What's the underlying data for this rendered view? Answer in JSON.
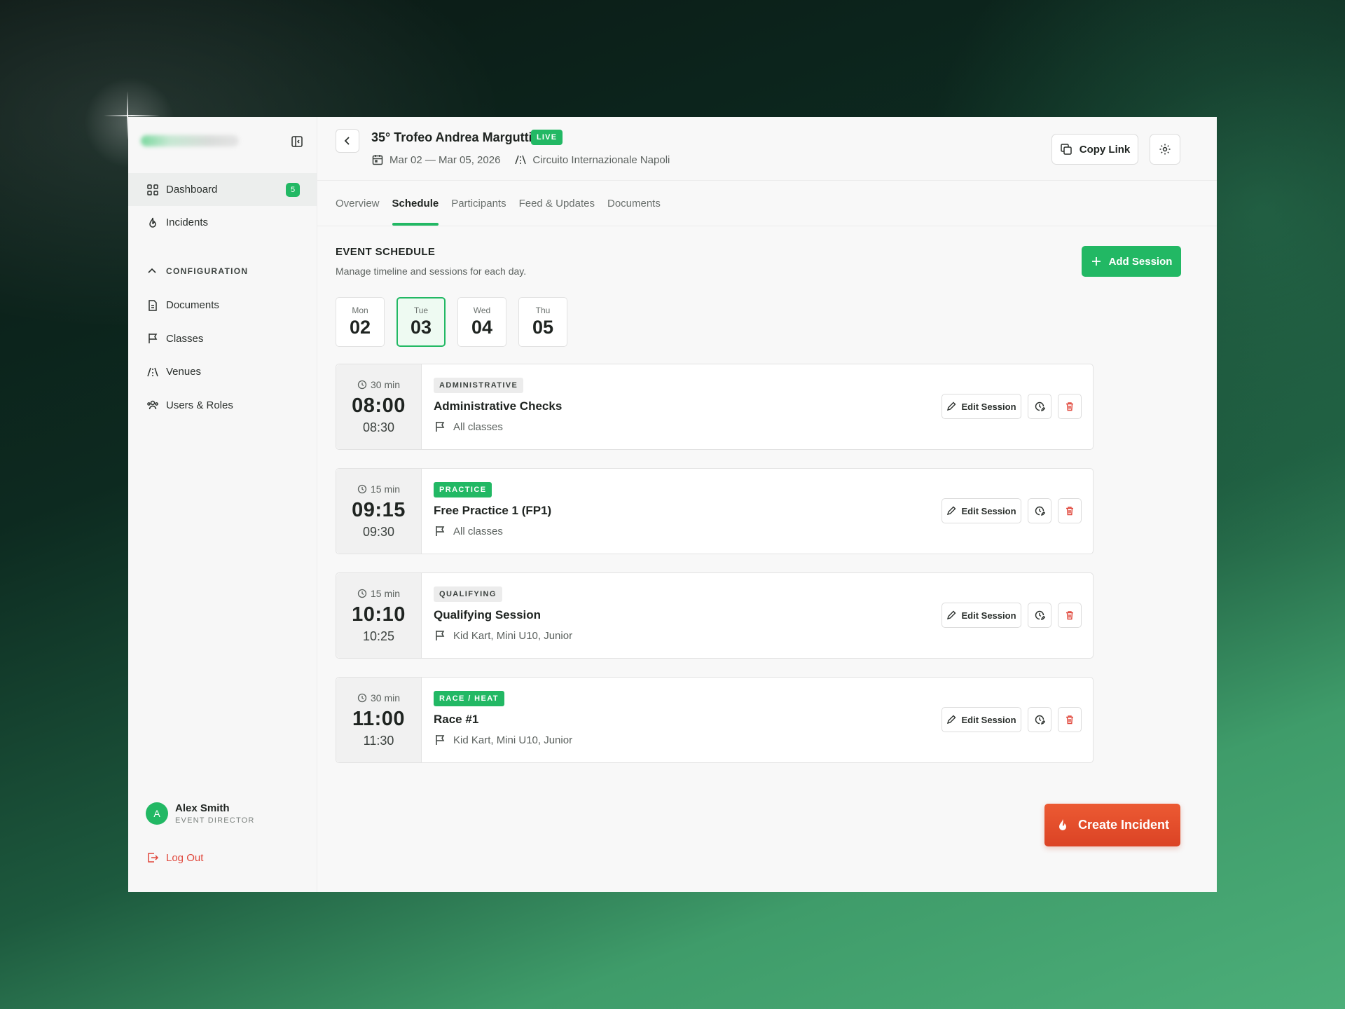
{
  "sidebar": {
    "nav": [
      {
        "label": "Dashboard",
        "icon": "grid-icon",
        "badge": "5",
        "active": true
      },
      {
        "label": "Incidents",
        "icon": "flame-icon"
      }
    ],
    "config_heading": "CONFIGURATION",
    "config_items": [
      {
        "label": "Documents",
        "icon": "document-icon"
      },
      {
        "label": "Classes",
        "icon": "flag-icon"
      },
      {
        "label": "Venues",
        "icon": "track-icon"
      },
      {
        "label": "Users & Roles",
        "icon": "users-icon"
      }
    ],
    "user": {
      "initial": "A",
      "name": "Alex Smith",
      "role": "EVENT DIRECTOR"
    },
    "logout_label": "Log Out"
  },
  "event": {
    "title": "35° Trofeo Andrea Margutti",
    "status": "LIVE",
    "dates": "Mar 02 — Mar 05, 2026",
    "venue": "Circuito Internazionale Napoli",
    "copy_label": "Copy Link"
  },
  "tabs": [
    {
      "label": "Overview"
    },
    {
      "label": "Schedule",
      "active": true
    },
    {
      "label": "Participants"
    },
    {
      "label": "Feed & Updates"
    },
    {
      "label": "Documents"
    }
  ],
  "schedule": {
    "title": "EVENT SCHEDULE",
    "subtitle": "Manage timeline and sessions for each day.",
    "add_label": "Add Session",
    "days": [
      {
        "name": "Mon",
        "num": "02"
      },
      {
        "name": "Tue",
        "num": "03",
        "active": true
      },
      {
        "name": "Wed",
        "num": "04"
      },
      {
        "name": "Thu",
        "num": "05"
      }
    ],
    "edit_label": "Edit Session",
    "sessions": [
      {
        "duration": "30 min",
        "start": "08:00",
        "end": "08:30",
        "tag": "ADMINISTRATIVE",
        "tag_style": "grey",
        "name": "Administrative Checks",
        "classes": "All classes"
      },
      {
        "duration": "15 min",
        "start": "09:15",
        "end": "09:30",
        "tag": "PRACTICE",
        "tag_style": "green",
        "name": "Free Practice 1 (FP1)",
        "classes": "All classes"
      },
      {
        "duration": "15 min",
        "start": "10:10",
        "end": "10:25",
        "tag": "QUALIFYING",
        "tag_style": "grey",
        "name": "Qualifying Session",
        "classes": "Kid Kart, Mini U10, Junior"
      },
      {
        "duration": "30 min",
        "start": "11:00",
        "end": "11:30",
        "tag": "RACE / HEAT",
        "tag_style": "green",
        "name": "Race #1",
        "classes": "Kid Kart, Mini U10, Junior"
      }
    ]
  },
  "create_incident_label": "Create Incident",
  "colors": {
    "accent": "#22b864",
    "danger": "#e0473b",
    "incident": "#e44d2c"
  }
}
